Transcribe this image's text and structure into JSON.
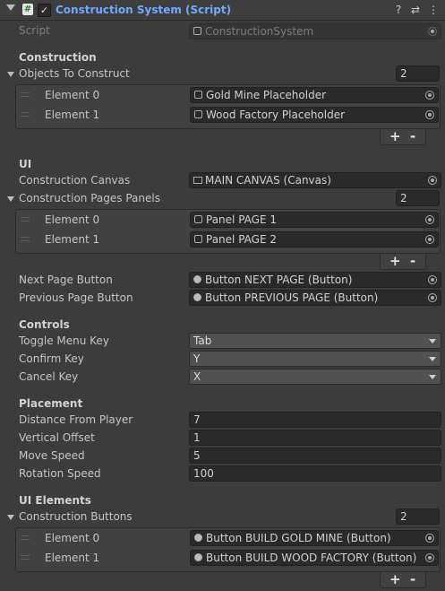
{
  "header": {
    "title": "Construction System (Script)",
    "script_icon": "#",
    "check_icon": "✓",
    "help_icon": "?",
    "presets_icon": "⇄",
    "menu_icon": "⋮"
  },
  "script_row": {
    "label": "Script",
    "value": "ConstructionSystem"
  },
  "construction": {
    "heading": "Construction",
    "objects_label": "Objects To Construct",
    "objects_count": "2",
    "objects": [
      {
        "label": "Element 0",
        "value": "Gold Mine Placeholder"
      },
      {
        "label": "Element 1",
        "value": "Wood Factory Placeholder"
      }
    ]
  },
  "ui": {
    "heading": "UI",
    "canvas_label": "Construction Canvas",
    "canvas_value": "MAIN CANVAS (Canvas)",
    "pages_label": "Construction Pages Panels",
    "pages_count": "2",
    "pages": [
      {
        "label": "Element 0",
        "value": "Panel PAGE 1"
      },
      {
        "label": "Element 1",
        "value": "Panel PAGE 2"
      }
    ],
    "next_label": "Next Page Button",
    "next_value": "Button NEXT PAGE (Button)",
    "prev_label": "Previous Page Button",
    "prev_value": "Button PREVIOUS PAGE (Button)"
  },
  "controls": {
    "heading": "Controls",
    "toggle_label": "Toggle Menu Key",
    "toggle_value": "Tab",
    "confirm_label": "Confirm Key",
    "confirm_value": "Y",
    "cancel_label": "Cancel Key",
    "cancel_value": "X"
  },
  "placement": {
    "heading": "Placement",
    "distance_label": "Distance From Player",
    "distance_value": "7",
    "vertical_label": "Vertical Offset",
    "vertical_value": "1",
    "move_label": "Move Speed",
    "move_value": "5",
    "rotation_label": "Rotation Speed",
    "rotation_value": "100"
  },
  "ui_elements": {
    "heading": "UI Elements",
    "buttons_label": "Construction Buttons",
    "buttons_count": "2",
    "buttons": [
      {
        "label": "Element 0",
        "value": "Button BUILD GOLD MINE (Button)"
      },
      {
        "label": "Element 1",
        "value": "Button BUILD WOOD FACTORY (Button)"
      }
    ]
  },
  "list_controls": {
    "plus": "+",
    "minus": "-"
  }
}
